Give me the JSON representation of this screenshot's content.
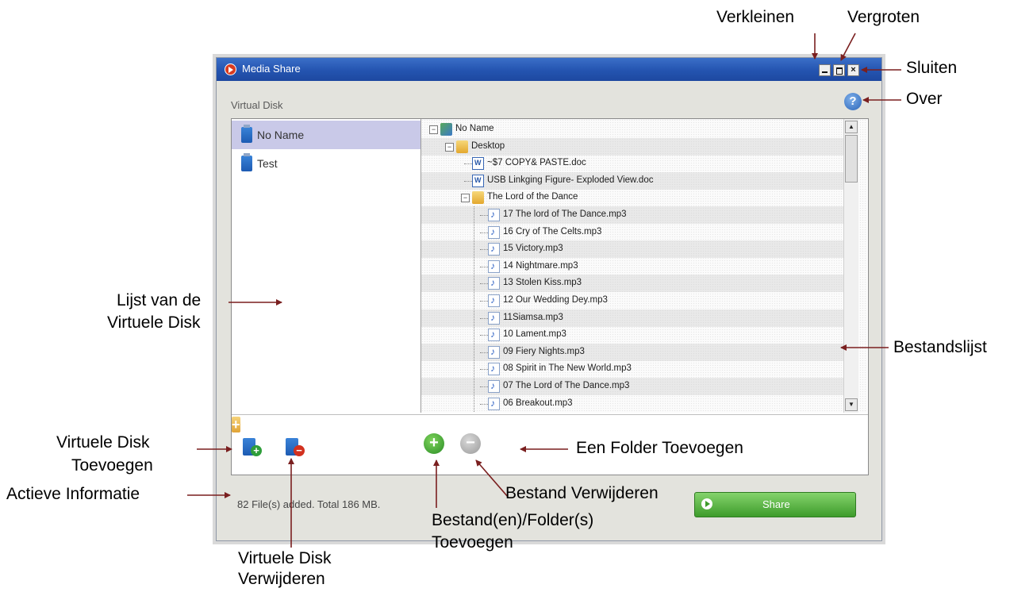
{
  "window": {
    "title": "Media Share",
    "section_label": "Virtual Disk",
    "controls": {
      "minimize": "minimize-icon",
      "maximize": "maximize-icon",
      "close": "×",
      "help": "?"
    }
  },
  "disks": [
    {
      "label": "No Name",
      "selected": true
    },
    {
      "label": "Test",
      "selected": false
    }
  ],
  "tree": [
    {
      "label": "No Name",
      "depth": 0,
      "icon": "network-drive-icon",
      "expander": "−"
    },
    {
      "label": "Desktop",
      "depth": 1,
      "icon": "folder-icon",
      "expander": "−"
    },
    {
      "label": "~$7 COPY& PASTE.doc",
      "depth": 2,
      "icon": "doc-icon"
    },
    {
      "label": "USB Linkging Figure- Exploded View.doc",
      "depth": 2,
      "icon": "doc-icon"
    },
    {
      "label": "The Lord of the Dance",
      "depth": 2,
      "icon": "folder-icon",
      "expander": "−"
    },
    {
      "label": "17 The lord of The Dance.mp3",
      "depth": 3,
      "icon": "mp3-icon"
    },
    {
      "label": "16 Cry of The Celts.mp3",
      "depth": 3,
      "icon": "mp3-icon"
    },
    {
      "label": "15 Victory.mp3",
      "depth": 3,
      "icon": "mp3-icon"
    },
    {
      "label": "14 Nightmare.mp3",
      "depth": 3,
      "icon": "mp3-icon"
    },
    {
      "label": "13 Stolen Kiss.mp3",
      "depth": 3,
      "icon": "mp3-icon"
    },
    {
      "label": "12 Our Wedding Dey.mp3",
      "depth": 3,
      "icon": "mp3-icon"
    },
    {
      "label": "11Siamsa.mp3",
      "depth": 3,
      "icon": "mp3-icon"
    },
    {
      "label": "10 Lament.mp3",
      "depth": 3,
      "icon": "mp3-icon"
    },
    {
      "label": "09 Fiery Nights.mp3",
      "depth": 3,
      "icon": "mp3-icon"
    },
    {
      "label": "08 Spirit in The New World.mp3",
      "depth": 3,
      "icon": "mp3-icon"
    },
    {
      "label": "07 The Lord of The Dance.mp3",
      "depth": 3,
      "icon": "mp3-icon"
    },
    {
      "label": "06 Breakout.mp3",
      "depth": 3,
      "icon": "mp3-icon"
    }
  ],
  "toolbar": {
    "add_disk": "+",
    "remove_disk": "−",
    "add_file": "+",
    "remove_file": "−",
    "add_folder": "+"
  },
  "status": "82 File(s) added. Total 186 MB.",
  "share_label": "Share",
  "callouts": {
    "minimize": "Verkleinen",
    "maximize": "Vergroten",
    "close": "Sluiten",
    "help": "Over",
    "disk_list": [
      "Lijst van de",
      "Virtuele Disk"
    ],
    "file_list": "Bestandslijst",
    "add_disk": [
      "Virtuele Disk",
      "Toevoegen"
    ],
    "status": "Actieve Informatie",
    "remove_disk": [
      "Virtuele Disk",
      "Verwijderen"
    ],
    "add_folder": "Een Folder Toevoegen",
    "remove_file": "Bestand Verwijderen",
    "add_file": [
      "Bestand(en)/Folder(s)",
      "Toevoegen"
    ]
  },
  "colors": {
    "title_bar": "#2454b0",
    "callout_arrow": "#7a1f1f",
    "share_button": "#4caf35"
  }
}
